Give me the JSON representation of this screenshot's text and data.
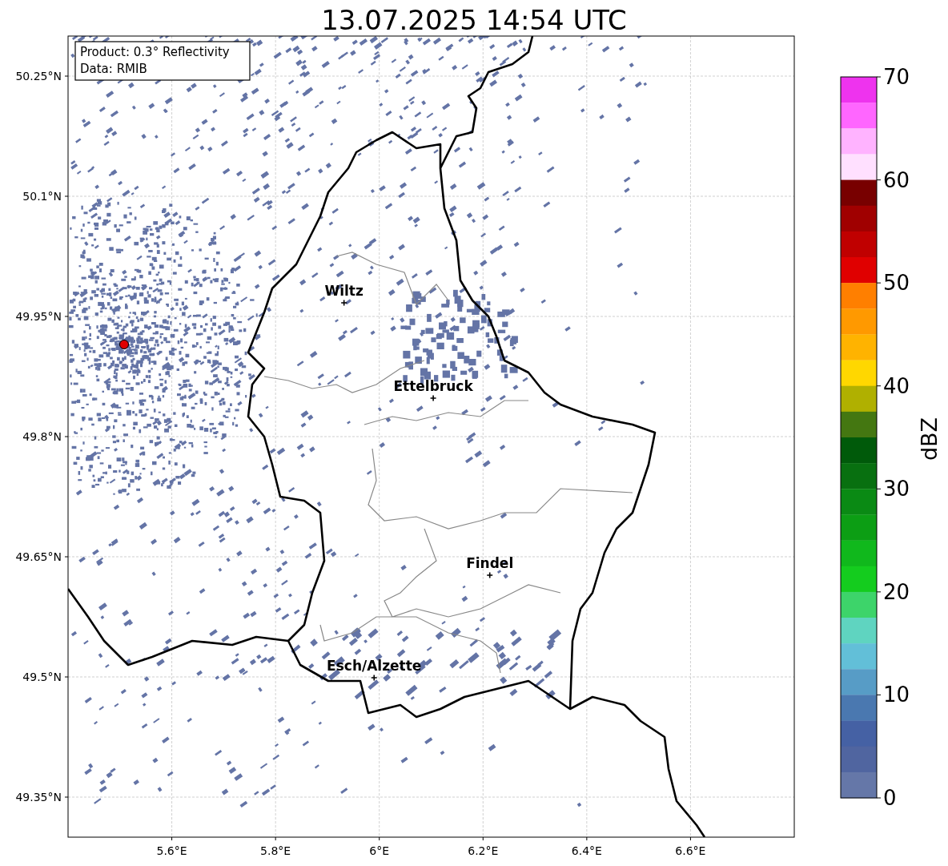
{
  "title": "13.07.2025 14:54 UTC",
  "info": [
    "Product: 0.3° Reflectivity",
    "Data: RMIB"
  ],
  "map": {
    "xticks": [
      "5.6°E",
      "5.8°E",
      "6°E",
      "6.2°E",
      "6.4°E",
      "6.6°E"
    ],
    "yticks": [
      "50.25°N",
      "50.1°N",
      "49.95°N",
      "49.8°N",
      "49.65°N",
      "49.5°N",
      "49.35°N"
    ],
    "cities": [
      {
        "name": "Wiltz"
      },
      {
        "name": "Ettelbruck"
      },
      {
        "name": "Findel"
      },
      {
        "name": "Esch/Alzette"
      }
    ]
  },
  "colorbar": {
    "label": "dBZ",
    "ticks": [
      "70",
      "60",
      "50",
      "40",
      "30",
      "20",
      "10",
      "0"
    ],
    "segments": [
      {
        "color": "#ee33ee"
      },
      {
        "color": "#ff66ff"
      },
      {
        "color": "#ffb3ff"
      },
      {
        "color": "#ffe0ff"
      },
      {
        "color": "#780000"
      },
      {
        "color": "#a00000"
      },
      {
        "color": "#c00000"
      },
      {
        "color": "#e00000"
      },
      {
        "color": "#ff7f00"
      },
      {
        "color": "#ff9900"
      },
      {
        "color": "#ffb300"
      },
      {
        "color": "#ffd700"
      },
      {
        "color": "#b0b000"
      },
      {
        "color": "#447711"
      },
      {
        "color": "#005a0a"
      },
      {
        "color": "#087010"
      },
      {
        "color": "#0a8a14"
      },
      {
        "color": "#0c9e14"
      },
      {
        "color": "#10b81c"
      },
      {
        "color": "#14cc1e"
      },
      {
        "color": "#3dd46a"
      },
      {
        "color": "#5fd4c0"
      },
      {
        "color": "#62bfd8"
      },
      {
        "color": "#579cc6"
      },
      {
        "color": "#4a78b0"
      },
      {
        "color": "#4561a4"
      },
      {
        "color": "#5065a0"
      },
      {
        "color": "#6577a8"
      }
    ]
  }
}
